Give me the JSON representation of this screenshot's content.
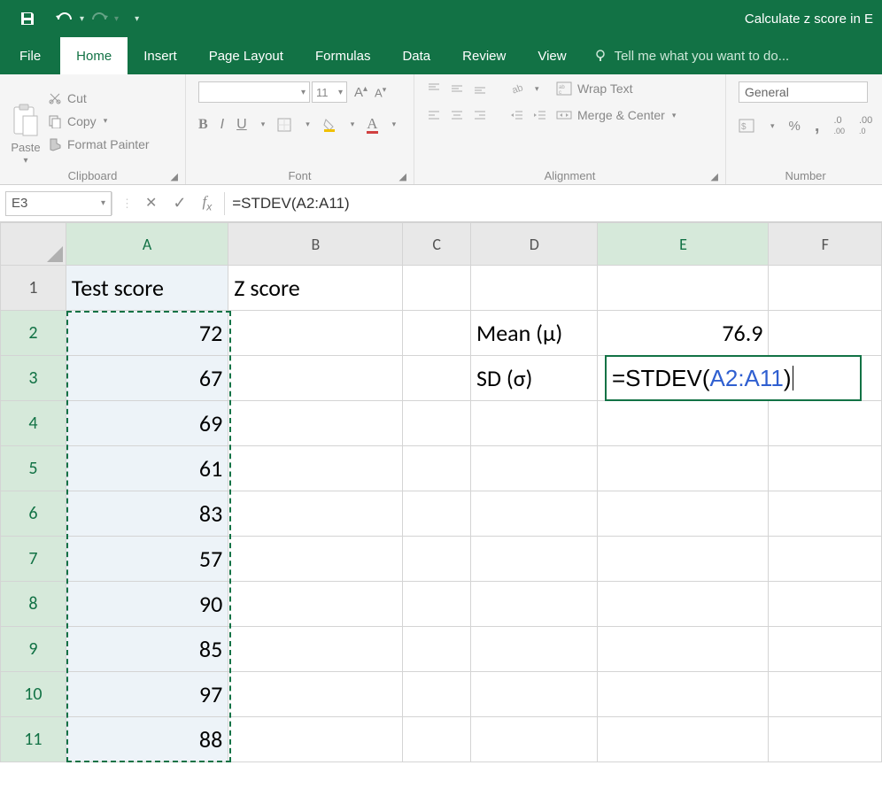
{
  "title": "Calculate z score in E",
  "qat": {
    "save": "save",
    "undo": "undo",
    "redo": "redo"
  },
  "tabs": {
    "file": "File",
    "home": "Home",
    "insert": "Insert",
    "page_layout": "Page Layout",
    "formulas": "Formulas",
    "data": "Data",
    "review": "Review",
    "view": "View",
    "tellme": "Tell me what you want to do..."
  },
  "ribbon": {
    "clipboard": {
      "paste": "Paste",
      "cut": "Cut",
      "copy": "Copy",
      "format_painter": "Format Painter",
      "label": "Clipboard"
    },
    "font": {
      "size": "11",
      "label": "Font",
      "b": "B",
      "i": "I",
      "u": "U"
    },
    "alignment": {
      "wrap": "Wrap Text",
      "merge": "Merge & Center",
      "label": "Alignment"
    },
    "number": {
      "select": "General",
      "label": "Number",
      "pct": "%",
      "comma": ",",
      "dec_inc": ".0 .00",
      "dec_dec": ".00 .0"
    }
  },
  "namebox": "E3",
  "formula": "=STDEV(A2:A11)",
  "columns": [
    "A",
    "B",
    "C",
    "D",
    "E",
    "F"
  ],
  "rows": [
    "1",
    "2",
    "3",
    "4",
    "5",
    "6",
    "7",
    "8",
    "9",
    "10",
    "11"
  ],
  "cells": {
    "A1": "Test score",
    "B1": "Z score",
    "A2": "72",
    "A3": "67",
    "A4": "69",
    "A5": "61",
    "A6": "83",
    "A7": "57",
    "A8": "90",
    "A9": "85",
    "A10": "97",
    "A11": "88",
    "D2": "Mean (μ)",
    "E2": "76.9",
    "D3": "SD (σ)"
  },
  "edit": {
    "pre": "=STDEV(",
    "ref": "A2:A11",
    "post": ")"
  },
  "chart_data": {
    "type": "table",
    "title": "Test scores with mean and formula for standard deviation",
    "series": [
      {
        "name": "Test score",
        "values": [
          72,
          67,
          69,
          61,
          83,
          57,
          90,
          85,
          97,
          88
        ]
      }
    ],
    "stats": {
      "mean": 76.9,
      "sd_formula": "=STDEV(A2:A11)"
    }
  }
}
